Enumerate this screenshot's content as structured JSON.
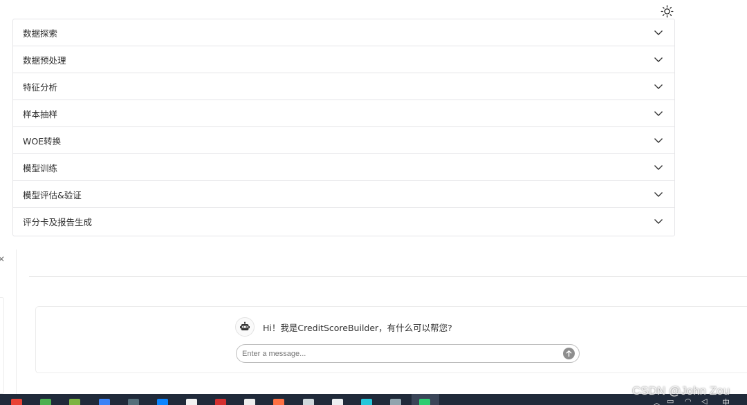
{
  "header": {
    "theme_toggle_icon": "sun-icon"
  },
  "accordion": {
    "items": [
      {
        "label": "数据探索"
      },
      {
        "label": "数据预处理"
      },
      {
        "label": "特征分析"
      },
      {
        "label": "样本抽样"
      },
      {
        "label": "WOE转换"
      },
      {
        "label": "模型训练"
      },
      {
        "label": "模型评估&验证"
      },
      {
        "label": "评分卡及报告生成"
      }
    ],
    "chevron_icon": "chevron-down-icon"
  },
  "chat": {
    "bot_avatar_icon": "robot-icon",
    "bot_greeting": "Hi！我是CreditScoreBuilder，有什么可以帮您?",
    "input": {
      "value": "",
      "placeholder": "Enter a message..."
    },
    "send_icon": "arrow-up-icon"
  },
  "watermark": {
    "text": "CSDN @John Zou"
  },
  "taskbar": {
    "apps": [
      {
        "icon": "chrome-icon",
        "color": "#e94235"
      },
      {
        "icon": "security-shield-icon",
        "color": "#4caf50"
      },
      {
        "icon": "feather-app-icon",
        "color": "#7cb342"
      },
      {
        "icon": "todo-app-icon",
        "color": "#3b82f6"
      },
      {
        "icon": "ide-app-icon",
        "color": "#546e7a"
      },
      {
        "icon": "vscode-icon",
        "color": "#0a84ff"
      },
      {
        "icon": "github-icon",
        "color": "#f2f2f2"
      },
      {
        "icon": "office-app-icon",
        "color": "#d32f2f"
      },
      {
        "icon": "terminal-app-icon",
        "color": "#eeeeee"
      },
      {
        "icon": "firefox-icon",
        "color": "#ff7043"
      },
      {
        "icon": "monitor-app-icon",
        "color": "#cfd8dc"
      },
      {
        "icon": "settings-gear-icon",
        "color": "#eceff1"
      },
      {
        "icon": "butterfly-app-icon",
        "color": "#26c6da"
      },
      {
        "icon": "paint-app-icon",
        "color": "#90a4ae"
      },
      {
        "icon": "wechat-icon",
        "color": "#2ecc71"
      }
    ],
    "tray": {
      "ime_label": "中"
    }
  }
}
